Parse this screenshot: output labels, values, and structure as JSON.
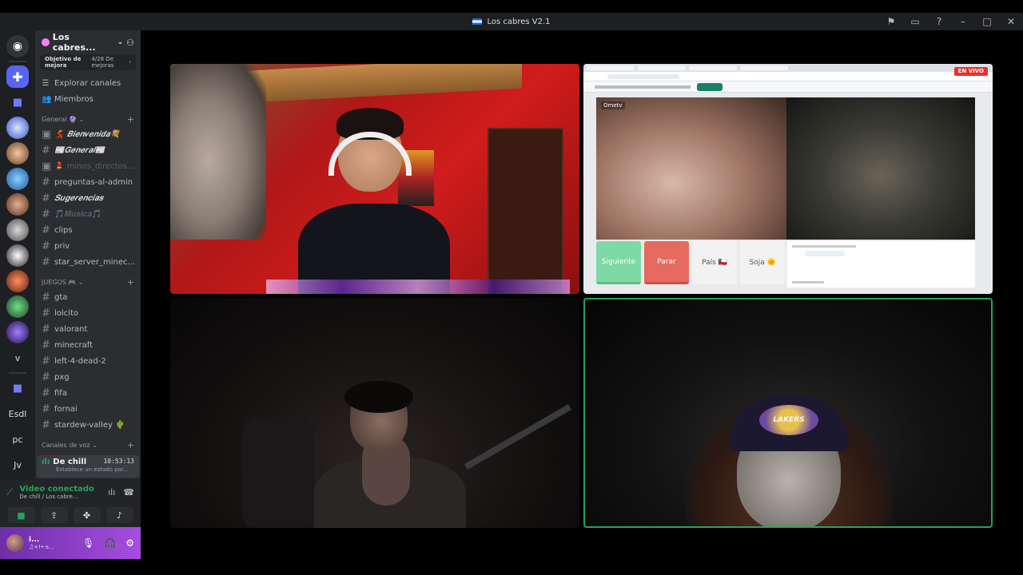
{
  "window": {
    "title": "Los cabres V2.1"
  },
  "server": {
    "name": "Los cabres...",
    "goal": {
      "label": "Objetivo de mejora",
      "value": "4/28 De mejoras"
    },
    "nav": [
      {
        "label": "Explorar canales",
        "icon": "compass-icon"
      },
      {
        "label": "Miembros",
        "icon": "members-icon"
      }
    ]
  },
  "guilds": {
    "text_items": [
      "v",
      "Esdl",
      "pc",
      "Jv"
    ]
  },
  "categories": {
    "general": "General 🔮",
    "juegos": "JUEGOS 🎮",
    "voz": "Canales de voz"
  },
  "channels_general": [
    {
      "label": "💃 𝑩𝒊𝒆𝒏𝒗𝒆𝒏𝒊𝒅𝒂💐",
      "style": "fancy"
    },
    {
      "label": "📰𝑮𝒆𝒏𝒆𝒓𝒂𝒍📰",
      "style": "fancy"
    },
    {
      "label": "💄 minos_directos...",
      "style": "muted"
    },
    {
      "label": "preguntas-al-admin",
      "style": "normal"
    },
    {
      "label": "𝑺𝒖𝒈𝒆𝒓𝒆𝒏𝒄𝒊𝒂𝒔",
      "style": "fancy"
    },
    {
      "label": "🎵𝑴𝒖𝒔𝒊𝒄𝒂🎵",
      "style": "muted"
    },
    {
      "label": "clips",
      "style": "normal"
    },
    {
      "label": "priv",
      "style": "normal"
    },
    {
      "label": "star_server_minec...",
      "style": "normal"
    }
  ],
  "channels_juegos": [
    "gta",
    "lolcito",
    "valorant",
    "minecraft",
    "left-4-dead-2",
    "pxg",
    "fifa",
    "fornai",
    "stardew-valley 🌵"
  ],
  "voice_channel": {
    "name": "De chill",
    "time": "10:53:13",
    "status": "Establece un estado par..."
  },
  "voice_panel": {
    "title": "Video conectado",
    "subtitle": "De chill / Los cabre..."
  },
  "user": {
    "name": "i...",
    "status": "♫+!•·s..."
  },
  "stream": {
    "live_label": "EN VIVO",
    "ometv_brand": "Ometv",
    "buttons": {
      "next": "Siguiente",
      "stop": "Parar",
      "country": "País 🇨🇱",
      "gender": "Soja 🌞"
    }
  },
  "colors": {
    "accent": "#5865f2",
    "online": "#23a55a",
    "live": "#e5322d",
    "sidebar": "#2b2d31"
  }
}
